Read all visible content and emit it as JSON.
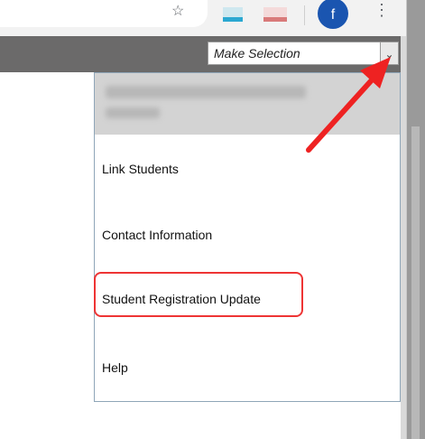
{
  "browser": {
    "star_icon": "star-icon",
    "profile_initial": "f",
    "menu_icon": "kebab-icon"
  },
  "header": {
    "select_value": "Make Selection",
    "select_chevron": "⌄"
  },
  "dropdown": {
    "items": [
      {
        "label": "Link Students"
      },
      {
        "label": "Contact Information"
      },
      {
        "label": "Student Registration Update"
      },
      {
        "label": "Help"
      }
    ]
  },
  "annotations": {
    "arrow_color": "#ee2222",
    "highlight_color": "#ee3434"
  }
}
